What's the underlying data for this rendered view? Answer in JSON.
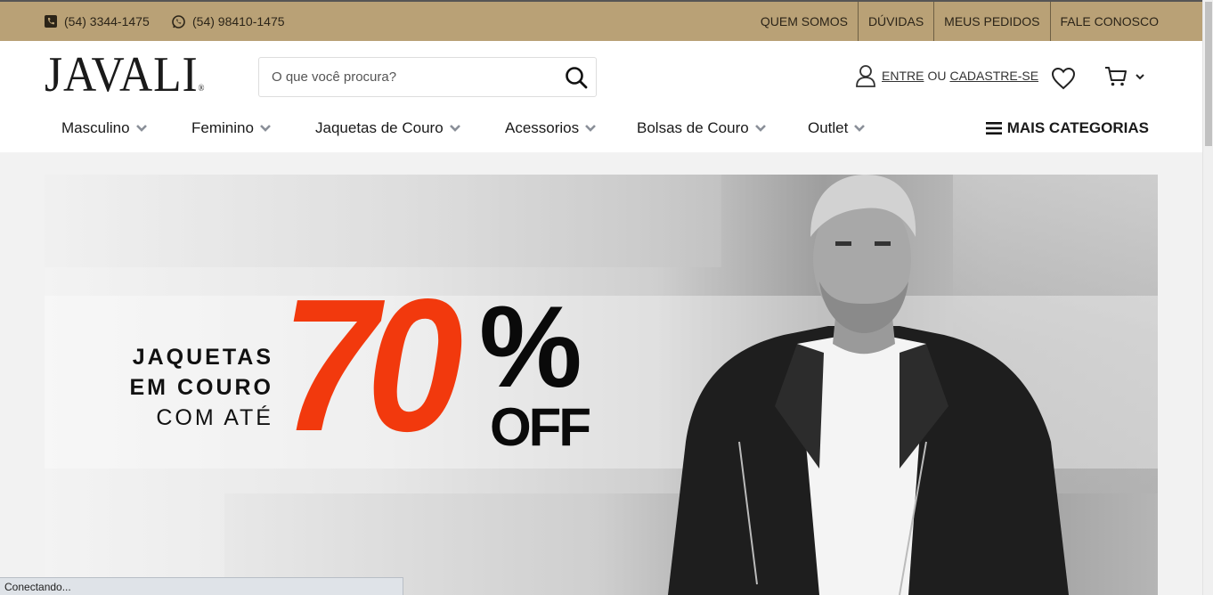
{
  "topbar": {
    "phone": "(54) 3344-1475",
    "whatsapp": "(54) 98410-1475",
    "links": [
      "QUEM SOMOS",
      "DÚVIDAS",
      "MEUS PEDIDOS",
      "FALE CONOSCO"
    ]
  },
  "header": {
    "logo": "JAVALI",
    "logo_mark": "®",
    "search_placeholder": "O que você procura?",
    "login_label": "ENTRE",
    "or_label": "OU",
    "register_label": "CADASTRE-SE"
  },
  "nav": {
    "items": [
      "Masculino",
      "Feminino",
      "Jaquetas de Couro",
      "Acessorios",
      "Bolsas de Couro",
      "Outlet"
    ],
    "more": "MAIS CATEGORIAS"
  },
  "banner": {
    "line1": "JAQUETAS",
    "line2": "EM COURO",
    "line3": "COM ATÉ",
    "discount": "70",
    "percent": "%",
    "off": "OFF"
  },
  "status": "Conectando...",
  "colors": {
    "topbar": "#b9a176",
    "accent_red": "#f2390d"
  }
}
